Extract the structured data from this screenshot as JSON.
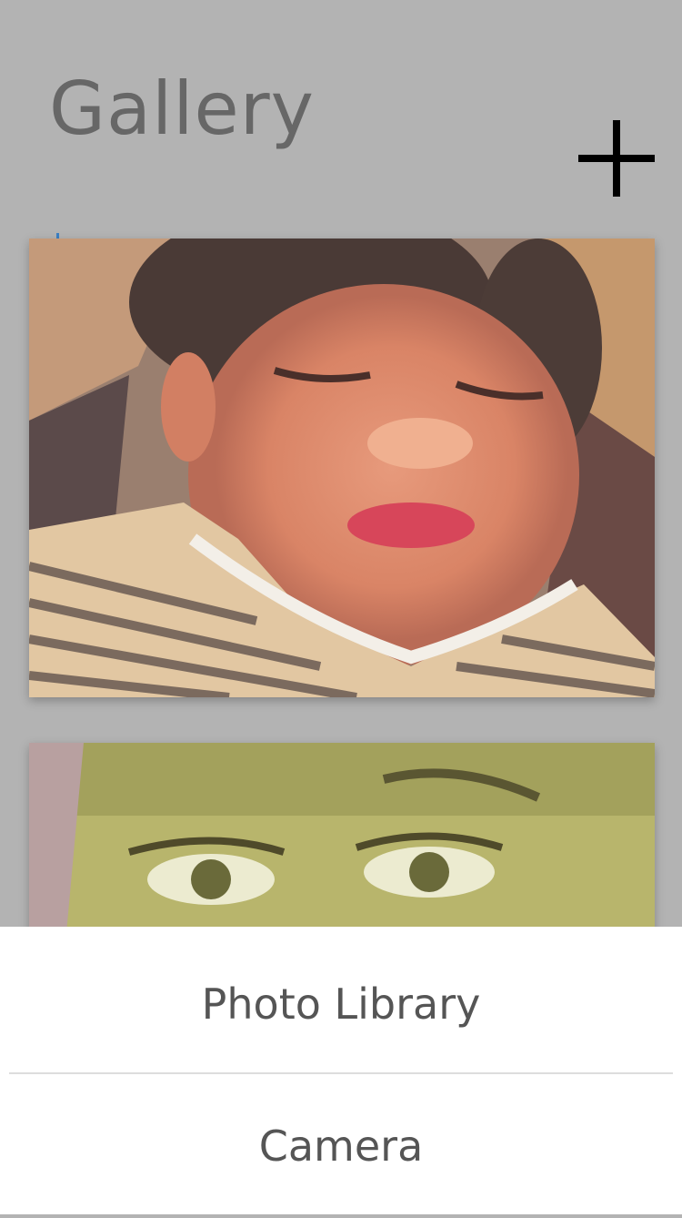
{
  "header": {
    "title": "Gallery",
    "add_icon": "plus-icon"
  },
  "gallery": {
    "photos": [
      {
        "subject": "stylized painting of a sleeping child"
      },
      {
        "subject": "stylized close-up of a child's eyes"
      }
    ]
  },
  "action_sheet": {
    "options": [
      {
        "label": "Photo Library"
      },
      {
        "label": "Camera"
      }
    ]
  },
  "colors": {
    "overlay_background": "#b3b3b3",
    "sheet_background": "#ffffff",
    "title_text": "#676767",
    "option_text": "#555555",
    "divider": "#dddddd"
  }
}
